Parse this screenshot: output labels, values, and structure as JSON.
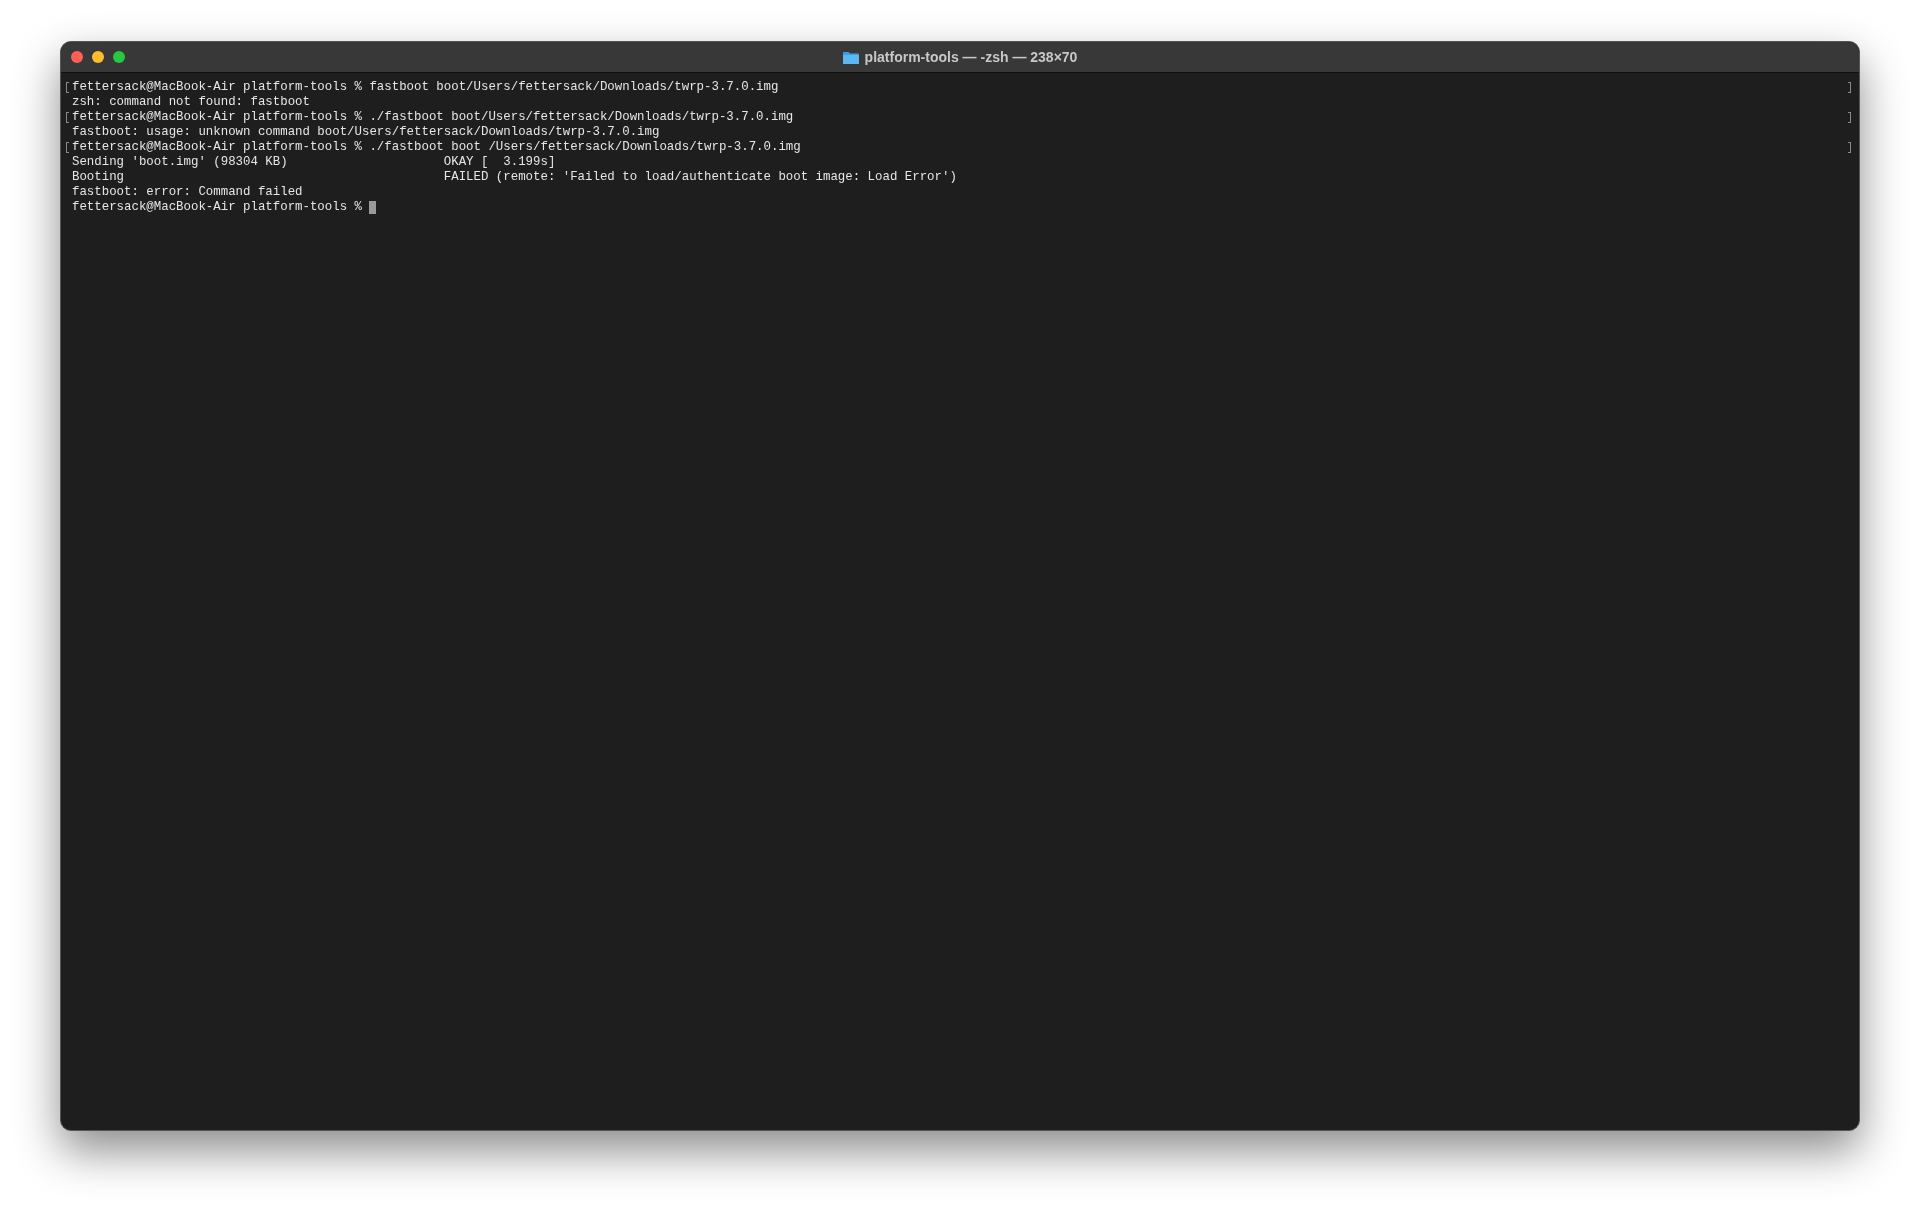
{
  "window": {
    "title": "platform-tools — -zsh — 238×70"
  },
  "terminal": {
    "lines": [
      {
        "kind": "marked",
        "text": "fettersack@MacBook-Air platform-tools % fastboot boot/Users/fettersack/Downloads/twrp-3.7.0.img"
      },
      {
        "kind": "output",
        "text": "zsh: command not found: fastboot"
      },
      {
        "kind": "marked",
        "text": "fettersack@MacBook-Air platform-tools % ./fastboot boot/Users/fettersack/Downloads/twrp-3.7.0.img"
      },
      {
        "kind": "output",
        "text": "fastboot: usage: unknown command boot/Users/fettersack/Downloads/twrp-3.7.0.img"
      },
      {
        "kind": "marked",
        "text": "fettersack@MacBook-Air platform-tools % ./fastboot boot /Users/fettersack/Downloads/twrp-3.7.0.img"
      },
      {
        "kind": "output",
        "text": "Sending 'boot.img' (98304 KB)                     OKAY [  3.199s]"
      },
      {
        "kind": "output",
        "text": "Booting                                           FAILED (remote: 'Failed to load/authenticate boot image: Load Error')"
      },
      {
        "kind": "output",
        "text": "fastboot: error: Command failed"
      },
      {
        "kind": "prompt",
        "text": "fettersack@MacBook-Air platform-tools % "
      }
    ]
  }
}
